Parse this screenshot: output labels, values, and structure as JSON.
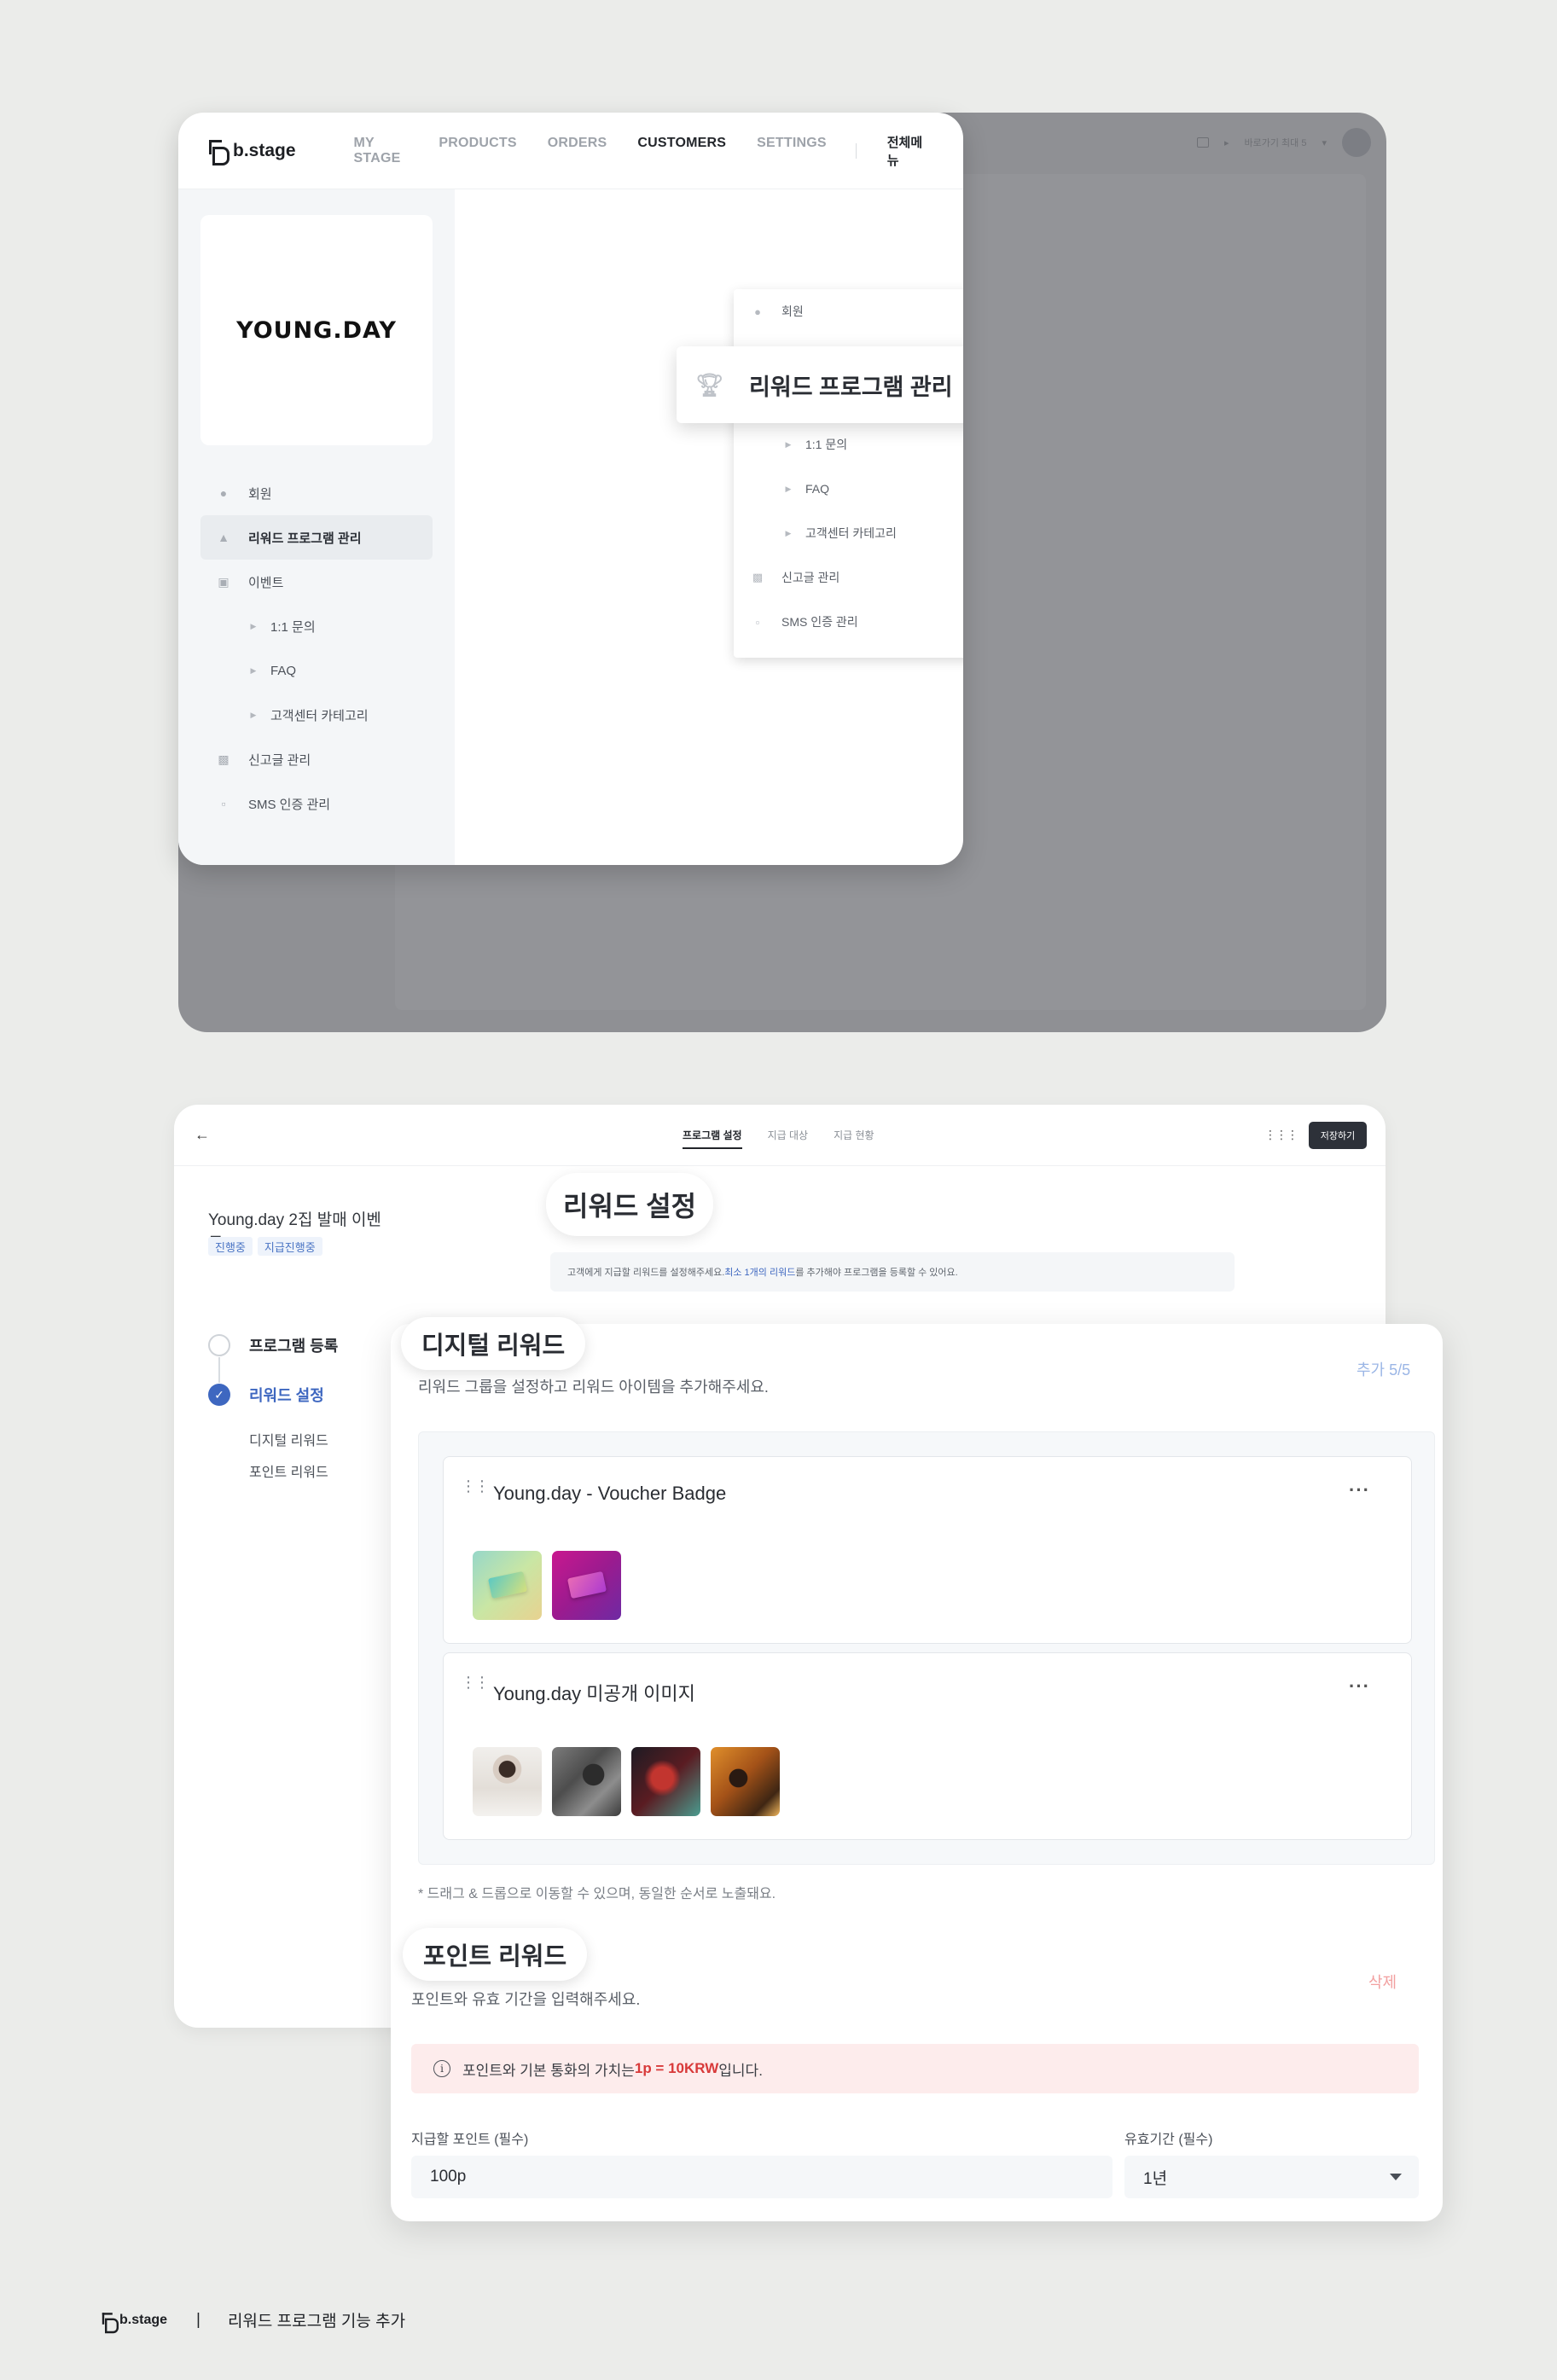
{
  "admin_mock": {
    "logo_text": "b.stage",
    "nav": [
      "MY STAGE",
      "PRODUCTS",
      "ORDERS",
      "CUSTOMERS",
      "SETTINGS"
    ],
    "nav_active": "CUSTOMERS",
    "all_menu": "전체메뉴",
    "brand_logo_text": "YOUNG.DAY",
    "background_bar": {
      "shortcut_label": "바로가기",
      "shortcut_sub": "최대 5"
    },
    "sidebar": [
      {
        "label": "회원",
        "icon": "person-icon",
        "type": "item"
      },
      {
        "label": "리워드 프로그램 관리",
        "icon": "trophy-icon",
        "type": "item",
        "selected": true
      },
      {
        "label": "이벤트",
        "icon": "calendar-icon",
        "type": "item"
      },
      {
        "label": "1:1 문의",
        "icon": "caret-right-icon",
        "type": "sub"
      },
      {
        "label": "FAQ",
        "icon": "caret-right-icon",
        "type": "sub"
      },
      {
        "label": "고객센터 카테고리",
        "icon": "caret-right-icon",
        "type": "sub"
      },
      {
        "label": "신고글 관리",
        "icon": "report-icon",
        "type": "item"
      },
      {
        "label": "SMS 인증 관리",
        "icon": "chat-icon",
        "type": "item"
      }
    ],
    "dropdown": [
      {
        "label": "회원",
        "type": "item"
      },
      {
        "label": "1:1 문의",
        "type": "sub"
      },
      {
        "label": "FAQ",
        "type": "sub"
      },
      {
        "label": "고객센터 카테고리",
        "type": "sub"
      },
      {
        "label": "신고글 관리",
        "type": "item"
      },
      {
        "label": "SMS 인증 관리",
        "type": "item"
      }
    ],
    "callout_label": "리워드 프로그램 관리"
  },
  "editor": {
    "tabs": [
      "프로그램 설정",
      "지급 대상",
      "지급 현황"
    ],
    "active_tab": "프로그램 설정",
    "save_label": "저장하기",
    "program_title": "Young.day 2집 발매 이벤트",
    "chips": [
      "진행중",
      "지급진행중"
    ],
    "steps": [
      {
        "label": "프로그램 등록",
        "state": "done"
      },
      {
        "label": "리워드 설정",
        "state": "current"
      }
    ],
    "substeps": [
      "디지털 리워드",
      "포인트 리워드"
    ],
    "section_title": "리워드 설정",
    "notice_pre": "고객에게 지급할 리워드를 설정해주세요. ",
    "notice_hl": "최소 1개의 리워드",
    "notice_post": "를 추가해야 프로그램을 등록할 수 있어요."
  },
  "digital_reward": {
    "title": "디지털 리워드",
    "desc": "리워드 그룹을 설정하고 리워드 아이템을 추가해주세요.",
    "counter": "추가 5/5",
    "groups": [
      {
        "title": "Young.day - Voucher Badge"
      },
      {
        "title": "Young.day 미공개 이미지"
      }
    ],
    "note": "* 드래그 & 드롭으로 이동할 수 있으며, 동일한 순서로 노출돼요."
  },
  "point_reward": {
    "title": "포인트 리워드",
    "desc": "포인트와 유효 기간을 입력해주세요.",
    "delete_label": "삭제",
    "warn_pre": "포인트와 기본 통화의 가치는 ",
    "warn_red": "1p = 10KRW",
    "warn_post": "입니다.",
    "points_label": "지급할 포인트 (필수)",
    "points_value": "100p",
    "period_label": "유효기간 (필수)",
    "period_value": "1년"
  },
  "footer": {
    "logo_text": "b.stage",
    "divider": "|",
    "caption": "리워드 프로그램 기능 추가"
  }
}
